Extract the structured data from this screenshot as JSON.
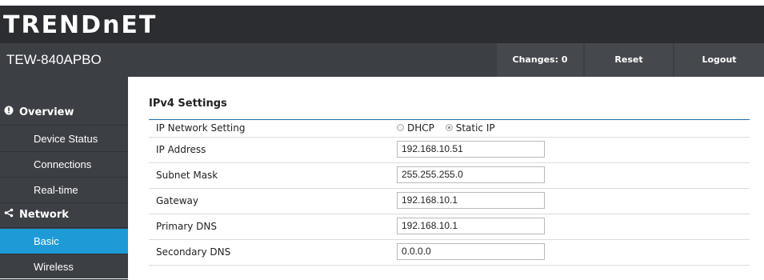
{
  "header": {
    "logo_text": "TRENDnET",
    "model": "TEW-840APBO",
    "buttons": {
      "changes": "Changes: 0",
      "reset": "Reset",
      "logout": "Logout"
    }
  },
  "sidebar": {
    "sections": [
      {
        "label": "Overview",
        "icon": "info-icon"
      },
      {
        "label": "Network",
        "icon": "share-icon"
      }
    ],
    "items": [
      {
        "label": "Device Status"
      },
      {
        "label": "Connections"
      },
      {
        "label": "Real-time"
      },
      {
        "label": "Basic"
      },
      {
        "label": "Wireless"
      }
    ],
    "active_item": "Basic"
  },
  "main": {
    "section_title": "IPv4 Settings",
    "rows": [
      {
        "label": "IP Network Setting"
      },
      {
        "label": "IP Address",
        "value": "192.168.10.51"
      },
      {
        "label": "Subnet Mask",
        "value": "255.255.255.0"
      },
      {
        "label": "Gateway",
        "value": "192.168.10.1"
      },
      {
        "label": "Primary DNS",
        "value": "192.168.10.1"
      },
      {
        "label": "Secondary DNS",
        "value": "0.0.0.0"
      }
    ],
    "radio_options": [
      {
        "label": "DHCP",
        "selected": false
      },
      {
        "label": "Static IP",
        "selected": true
      }
    ]
  },
  "colors": {
    "accent": "#1e9bd7",
    "sidebar_bg": "#3c3f44",
    "header_bg": "#2b2d30"
  }
}
